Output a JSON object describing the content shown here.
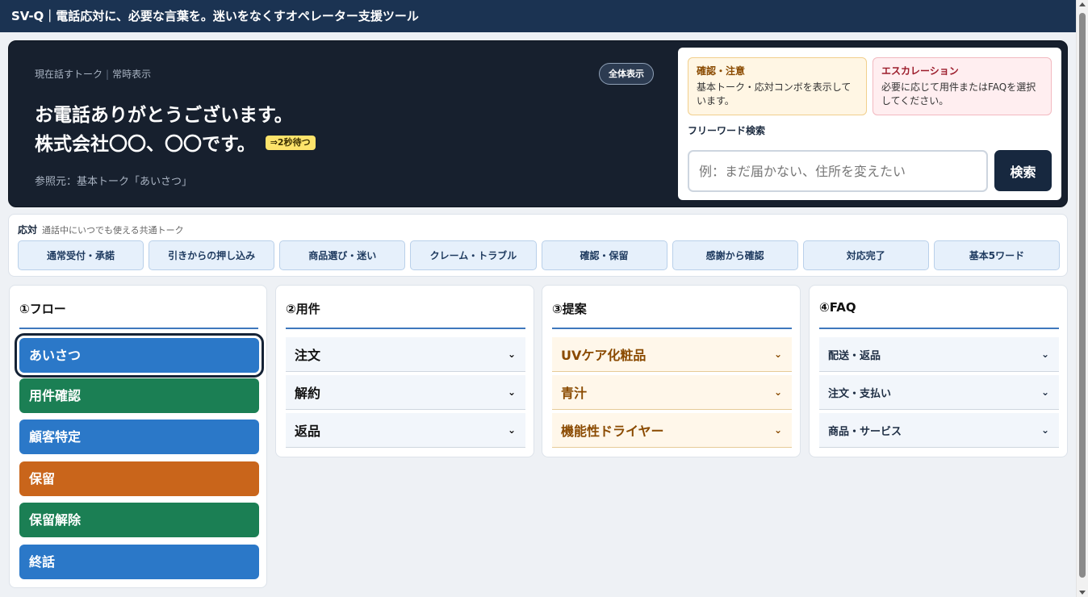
{
  "header": {
    "title": "SV-Q｜電話応対に、必要な言葉を。迷いをなくすオペレーター支援ツール"
  },
  "hero": {
    "label": "現在話すトーク",
    "label_sep": "|",
    "label_sub": "常時表示",
    "all_button": "全体表示",
    "talk_line1": "お電話ありがとうございます。",
    "talk_line2": "株式会社〇〇、〇〇です。",
    "wait_badge": "⇒2秒待つ",
    "reference": "参照元：基本トーク「あいさつ」"
  },
  "side": {
    "confirm": {
      "title": "確認・注意",
      "text": "基本トーク・応対コンボを表示しています。"
    },
    "escalation": {
      "title": "エスカレーション",
      "text": "必要に応じて用件またはFAQを選択してください。"
    },
    "free_word_label": "フリーワード検索",
    "search_placeholder": "例：まだ届かない、住所を変えたい",
    "search_button": "検索"
  },
  "combo": {
    "title": "応対",
    "subtitle": "通話中にいつでも使える共通トーク",
    "buttons": [
      "通常受付・承諾",
      "引きからの押し込み",
      "商品選び・迷い",
      "クレーム・トラブル",
      "確認・保留",
      "感謝から確認",
      "対応完了",
      "基本5ワード"
    ]
  },
  "flow": {
    "heading": "①フロー",
    "items": [
      "あいさつ",
      "用件確認",
      "顧客特定",
      "保留",
      "保留解除",
      "終話"
    ],
    "colors": [
      "#2b78c8",
      "#1b7f54",
      "#2b78c8",
      "#c9651b",
      "#1b7f54",
      "#2b78c8"
    ],
    "active_index": 0
  },
  "yoken": {
    "heading": "②用件",
    "items": [
      "注文",
      "解約",
      "返品"
    ]
  },
  "teian": {
    "heading": "③提案",
    "items": [
      "UVケア化粧品",
      "青汁",
      "機能性ドライヤー"
    ]
  },
  "faq": {
    "heading": "④FAQ",
    "items": [
      "配送・返品",
      "注文・支払い",
      "商品・サービス"
    ]
  },
  "chevron": "⌄"
}
